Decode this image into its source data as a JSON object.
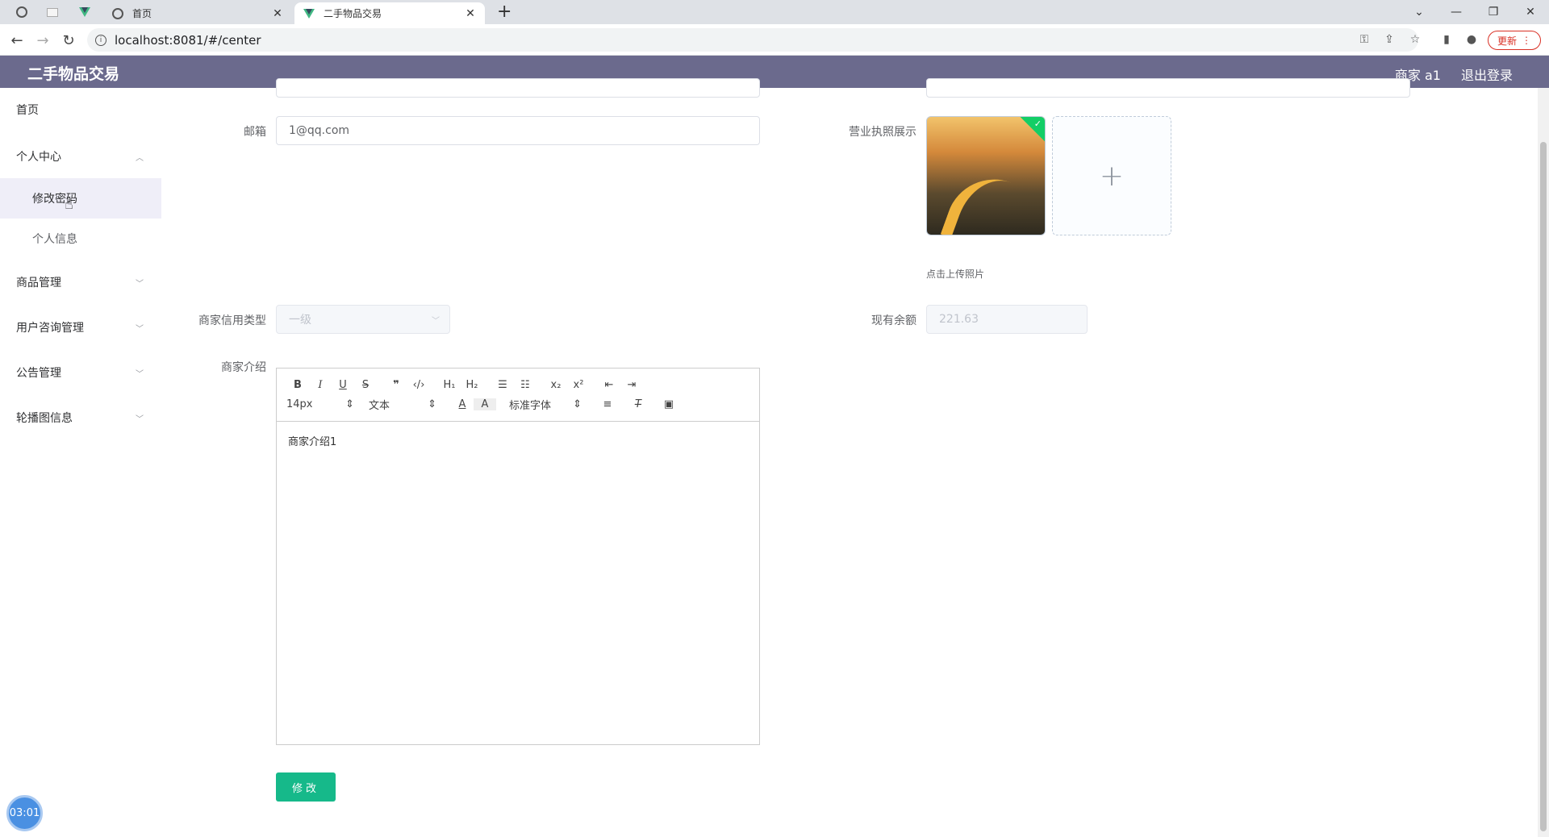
{
  "browser": {
    "tabs": [
      {
        "title": "首页"
      },
      {
        "title": "二手物品交易"
      }
    ],
    "url": "localhost:8081/#/center",
    "update_label": "更新"
  },
  "header": {
    "title": "二手物品交易",
    "user": "商家 a1",
    "logout": "退出登录"
  },
  "sidebar": {
    "items": [
      {
        "label": "首页"
      },
      {
        "label": "个人中心"
      },
      {
        "label": "修改密码"
      },
      {
        "label": "个人信息"
      },
      {
        "label": "商品管理"
      },
      {
        "label": "用户咨询管理"
      },
      {
        "label": "公告管理"
      },
      {
        "label": "轮播图信息"
      }
    ]
  },
  "form": {
    "email_label": "邮箱",
    "email_value": "1@qq.com",
    "license_label": "营业执照展示",
    "upload_tip": "点击上传照片",
    "credit_label": "商家信用类型",
    "credit_value": "一级",
    "balance_label": "现有余额",
    "balance_value": "221.63",
    "intro_label": "商家介绍",
    "intro_value": "商家介绍1",
    "submit_label": "修改"
  },
  "editor": {
    "font_size": "14px",
    "block_type": "文本",
    "font_family": "标准字体"
  },
  "timer": "03:01"
}
